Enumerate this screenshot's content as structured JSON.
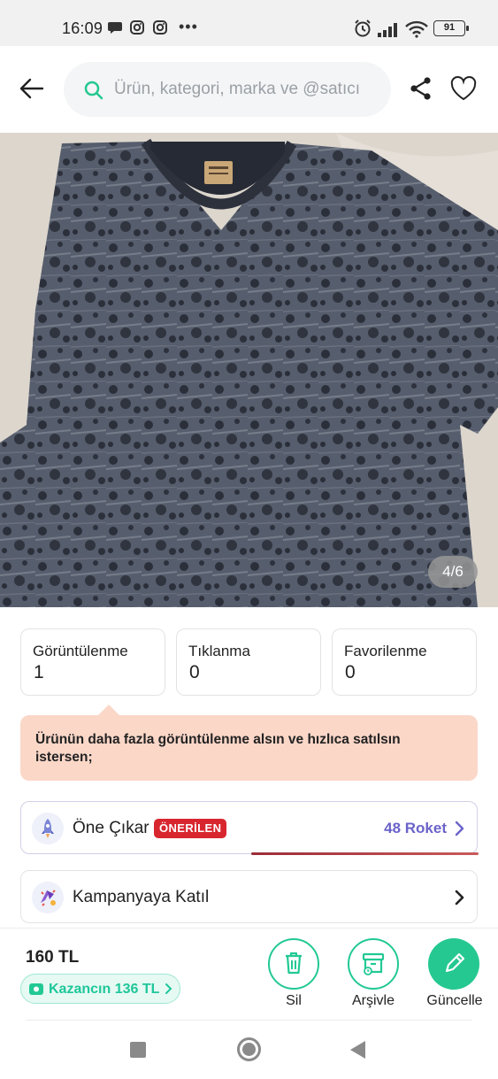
{
  "status_bar": {
    "time": "16:09",
    "dots": "•••",
    "battery": "91",
    "notification_icons": [
      "chat-bubble-icon",
      "instagram-icon",
      "instagram-icon"
    ],
    "system_icons": [
      "alarm-icon",
      "signal-icon",
      "wifi-icon",
      "battery-icon"
    ]
  },
  "header": {
    "search_placeholder": "Ürün, kategori, marka ve @satıcı",
    "icons": [
      "back-arrow-icon",
      "search-icon",
      "share-icon",
      "heart-icon"
    ]
  },
  "gallery": {
    "counter": "4/6",
    "current": 4,
    "total": 6
  },
  "stats": [
    {
      "label": "Görüntülenme",
      "value": "1"
    },
    {
      "label": "Tıklanma",
      "value": "0"
    },
    {
      "label": "Favorilenme",
      "value": "0"
    }
  ],
  "promo": {
    "text": "Ürünün daha fazla görüntülenme alsın ve hızlıca satılsın istersen;"
  },
  "actions": {
    "feature": {
      "label": "Öne Çıkar",
      "badge": "ÖNERİLEN",
      "cost": "48 Roket",
      "icon": "rocket-icon"
    },
    "campaign": {
      "label": "Kampanyaya Katıl",
      "icon": "campaign-icon"
    }
  },
  "bottom_bar": {
    "price": "160 TL",
    "earn": "Kazancın 136 TL",
    "buttons": {
      "delete": "Sil",
      "archive": "Arşivle",
      "update": "Güncelle"
    }
  },
  "colors": {
    "accent_green": "#25c890",
    "promo_bg": "#fbd7c8",
    "badge_red": "#d8262f",
    "roket_purple": "#6a63c9"
  }
}
